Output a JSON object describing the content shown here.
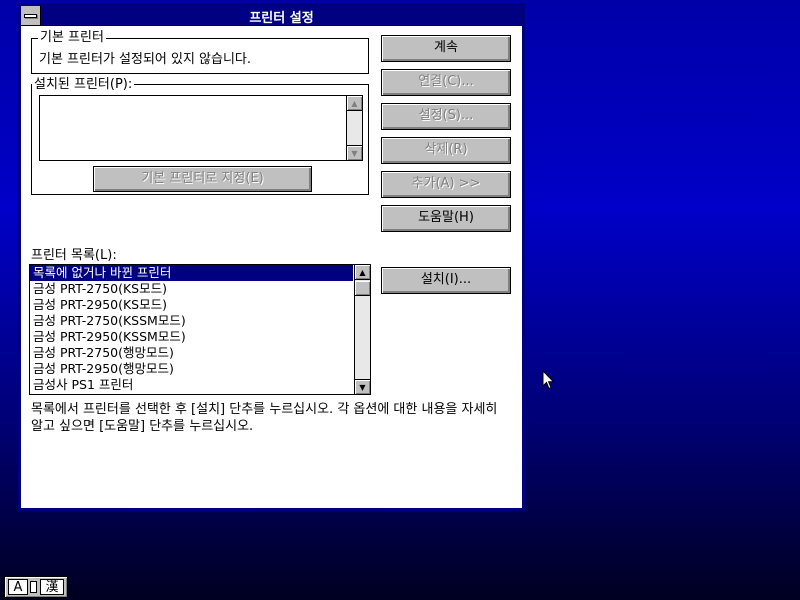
{
  "window": {
    "title": "프린터 설정"
  },
  "default_printer": {
    "legend": "기본 프린터",
    "text": "기본 프린터가 설정되어 있지 않습니다."
  },
  "installed": {
    "label": "설치된 프린터(P):",
    "set_default_button": "기본 프린터로 지정(E)"
  },
  "buttons": {
    "continue": "계속",
    "connect": "연결(C)...",
    "setup": "설정(S)...",
    "remove": "삭제(R)",
    "add": "추가(A) >>",
    "help": "도움말(H)",
    "install": "설치(I)..."
  },
  "printer_list": {
    "label": "프린터 목록(L):",
    "items": [
      "목록에 없거나 바뀐 프린터",
      "금성 PRT-2750(KS모드)",
      "금성 PRT-2950(KS모드)",
      "금성 PRT-2750(KSSM모드)",
      "금성 PRT-2950(KSSM모드)",
      "금성 PRT-2750(행망모드)",
      "금성 PRT-2950(행망모드)",
      "금성사 PS1 프린터"
    ],
    "selected_index": 0
  },
  "help_text": "목록에서 프린터를 선택한 후 [설치] 단추를 누르십시오. 각 옵션에 대한 내용을 자세히 알고 싶으면 [도움말] 단추를 누르십시오.",
  "taskbar": {
    "ime_left": "A",
    "ime_right": "漢"
  }
}
